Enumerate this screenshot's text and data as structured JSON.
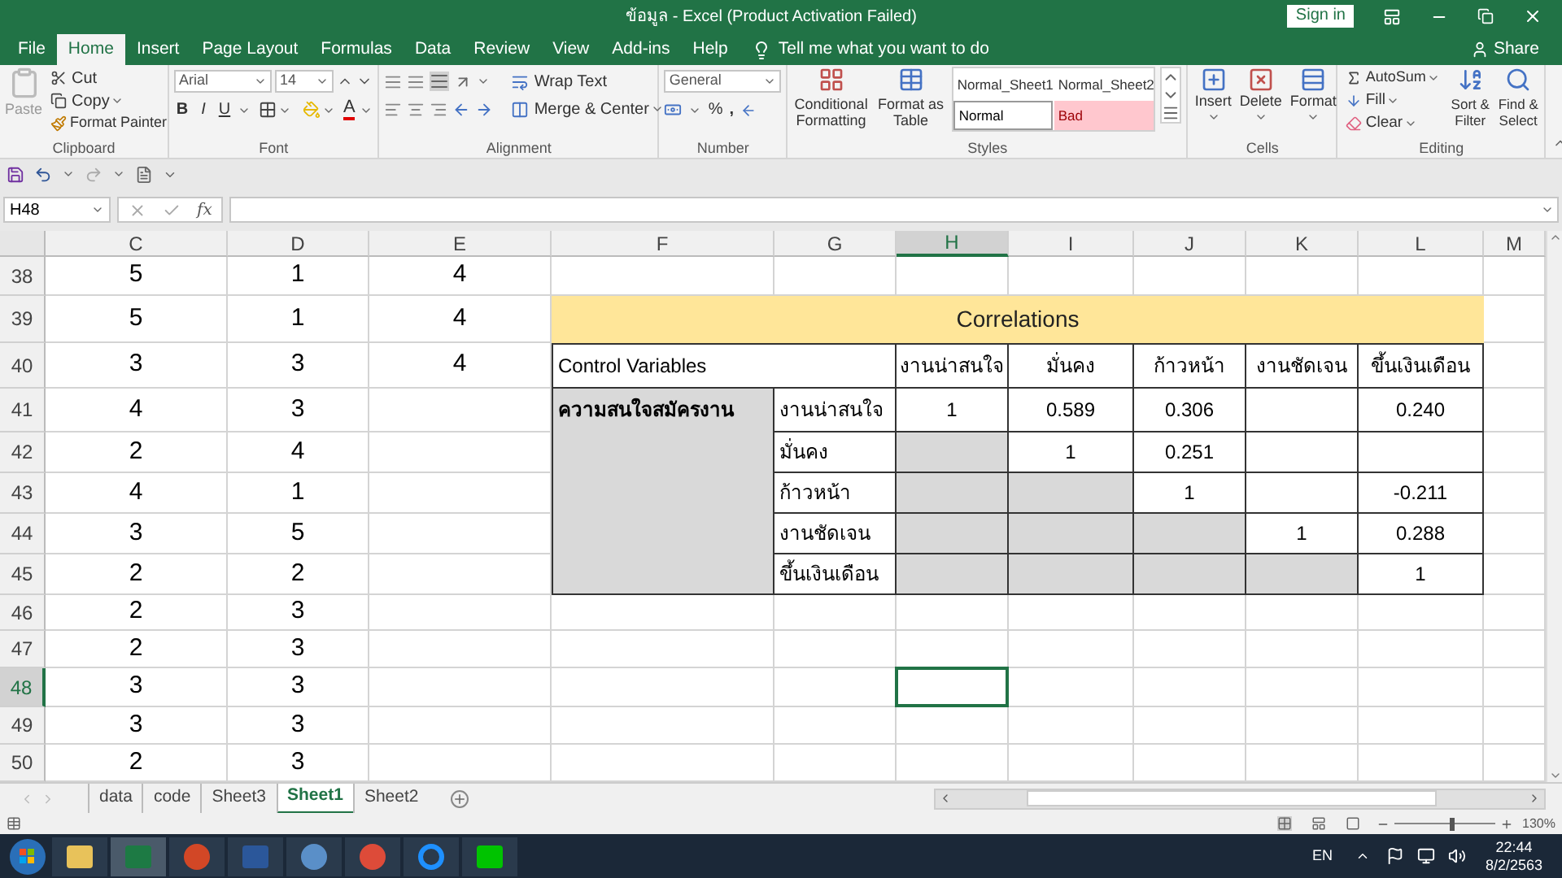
{
  "title_bar": {
    "title": "ข้อมูล - Excel (Product Activation Failed)",
    "sign_in": "Sign in"
  },
  "menu_tabs": [
    {
      "label": "File",
      "selected": false
    },
    {
      "label": "Home",
      "selected": true
    },
    {
      "label": "Insert",
      "selected": false
    },
    {
      "label": "Page Layout",
      "selected": false
    },
    {
      "label": "Formulas",
      "selected": false
    },
    {
      "label": "Data",
      "selected": false
    },
    {
      "label": "Review",
      "selected": false
    },
    {
      "label": "View",
      "selected": false
    },
    {
      "label": "Add-ins",
      "selected": false
    },
    {
      "label": "Help",
      "selected": false
    }
  ],
  "tell_me": "Tell me what you want to do",
  "share": "Share",
  "ribbon": {
    "clipboard": {
      "paste": "Paste",
      "cut": "Cut",
      "copy": "Copy",
      "format_painter": "Format Painter",
      "label": "Clipboard"
    },
    "font": {
      "font_name": "Arial",
      "font_size": "14",
      "bold": "B",
      "italic": "I",
      "underline": "U",
      "font_color": "A",
      "label": "Font"
    },
    "alignment": {
      "wrap_text": "Wrap Text",
      "merge_center": "Merge & Center",
      "label": "Alignment"
    },
    "number": {
      "format": "General",
      "percent": "%",
      "comma": ",",
      "label": "Number"
    },
    "styles": {
      "conditional": "Conditional Formatting",
      "format_table": "Format as Table",
      "gallery": [
        {
          "label": "Normal_Sheet1",
          "kind": "plain"
        },
        {
          "label": "Normal_Sheet2",
          "kind": "plain"
        },
        {
          "label": "Normal",
          "kind": "normal"
        },
        {
          "label": "Bad",
          "kind": "bad"
        }
      ],
      "label": "Styles"
    },
    "cells": {
      "buttons": [
        "Insert",
        "Delete",
        "Format"
      ],
      "label": "Cells"
    },
    "editing": {
      "autosum": "AutoSum",
      "fill": "Fill",
      "clear": "Clear",
      "sort": "Sort & Filter",
      "find": "Find & Select",
      "label": "Editing"
    }
  },
  "formula_bar": {
    "name_box": "H48",
    "fx": "fx"
  },
  "sheet": {
    "columns": [
      {
        "label": "C",
        "selected": false
      },
      {
        "label": "D",
        "selected": false
      },
      {
        "label": "E",
        "selected": false
      },
      {
        "label": "F",
        "selected": false
      },
      {
        "label": "G",
        "selected": false
      },
      {
        "label": "H",
        "selected": true
      },
      {
        "label": "I",
        "selected": false
      },
      {
        "label": "J",
        "selected": false
      },
      {
        "label": "K",
        "selected": false
      },
      {
        "label": "L",
        "selected": false
      },
      {
        "label": "M",
        "selected": false
      }
    ],
    "rows": [
      {
        "number": "38",
        "selected": false,
        "cells": [
          "5",
          "1",
          "4"
        ]
      },
      {
        "number": "39",
        "selected": false,
        "cells": [
          "5",
          "1",
          "4"
        ]
      },
      {
        "number": "40",
        "selected": false,
        "cells": [
          "3",
          "3",
          "4"
        ]
      },
      {
        "number": "41",
        "selected": false,
        "cells": [
          "4",
          "3"
        ]
      },
      {
        "number": "42",
        "selected": false,
        "cells": [
          "2",
          "4"
        ]
      },
      {
        "number": "43",
        "selected": false,
        "cells": [
          "4",
          "1"
        ]
      },
      {
        "number": "44",
        "selected": false,
        "cells": [
          "3",
          "5"
        ]
      },
      {
        "number": "45",
        "selected": false,
        "cells": [
          "2",
          "2"
        ]
      },
      {
        "number": "46",
        "selected": false,
        "cells": [
          "2",
          "3"
        ]
      },
      {
        "number": "47",
        "selected": false,
        "cells": [
          "2",
          "3"
        ]
      },
      {
        "number": "48",
        "selected": true,
        "cells": [
          "3",
          "3"
        ]
      },
      {
        "number": "49",
        "selected": false,
        "cells": [
          "3",
          "3"
        ]
      },
      {
        "number": "50",
        "selected": false,
        "cells": [
          "2",
          "3"
        ]
      }
    ]
  },
  "correlations": {
    "title": "Correlations",
    "control_label": "Control Variables",
    "headers": [
      "งานน่าสนใจ",
      "มั่นคง",
      "ก้าวหน้า",
      "งานชัดเจน",
      "ขึ้นเงินเดือน"
    ],
    "group_label": "ความสนใจสมัครงาน",
    "rows": [
      {
        "label": "งานน่าสนใจ",
        "cells": [
          {
            "value": "1",
            "shaded": false
          },
          {
            "value": "0.589",
            "shaded": false
          },
          {
            "value": "0.306",
            "shaded": false
          },
          {
            "shaded": false
          },
          {
            "value": "0.240",
            "shaded": false
          }
        ]
      },
      {
        "label": "มั่นคง",
        "cells": [
          {
            "shaded": true
          },
          {
            "value": "1",
            "shaded": false
          },
          {
            "value": "0.251",
            "shaded": false
          },
          {
            "shaded": false
          },
          {
            "shaded": false
          }
        ]
      },
      {
        "label": "ก้าวหน้า",
        "cells": [
          {
            "shaded": true
          },
          {
            "shaded": true
          },
          {
            "value": "1",
            "shaded": false
          },
          {
            "shaded": false
          },
          {
            "value": "-0.211",
            "shaded": false
          }
        ]
      },
      {
        "label": "งานชัดเจน",
        "cells": [
          {
            "shaded": true
          },
          {
            "shaded": true
          },
          {
            "shaded": true
          },
          {
            "value": "1",
            "shaded": false
          },
          {
            "value": "0.288",
            "shaded": false
          }
        ]
      },
      {
        "label": "ขึ้นเงินเดือน",
        "cells": [
          {
            "shaded": true
          },
          {
            "shaded": true
          },
          {
            "shaded": true
          },
          {
            "shaded": true
          },
          {
            "value": "1",
            "shaded": false
          }
        ]
      }
    ]
  },
  "sheet_tabs": [
    {
      "label": "data",
      "selected": false
    },
    {
      "label": "code",
      "selected": false
    },
    {
      "label": "Sheet3",
      "selected": false
    },
    {
      "label": "Sheet1",
      "selected": true
    },
    {
      "label": "Sheet2",
      "selected": false
    }
  ],
  "status_bar": {
    "zoom": "130%",
    "level": 0.55
  },
  "taskbar": {
    "language": "EN",
    "time": "22:44",
    "date": "8/2/2563"
  }
}
